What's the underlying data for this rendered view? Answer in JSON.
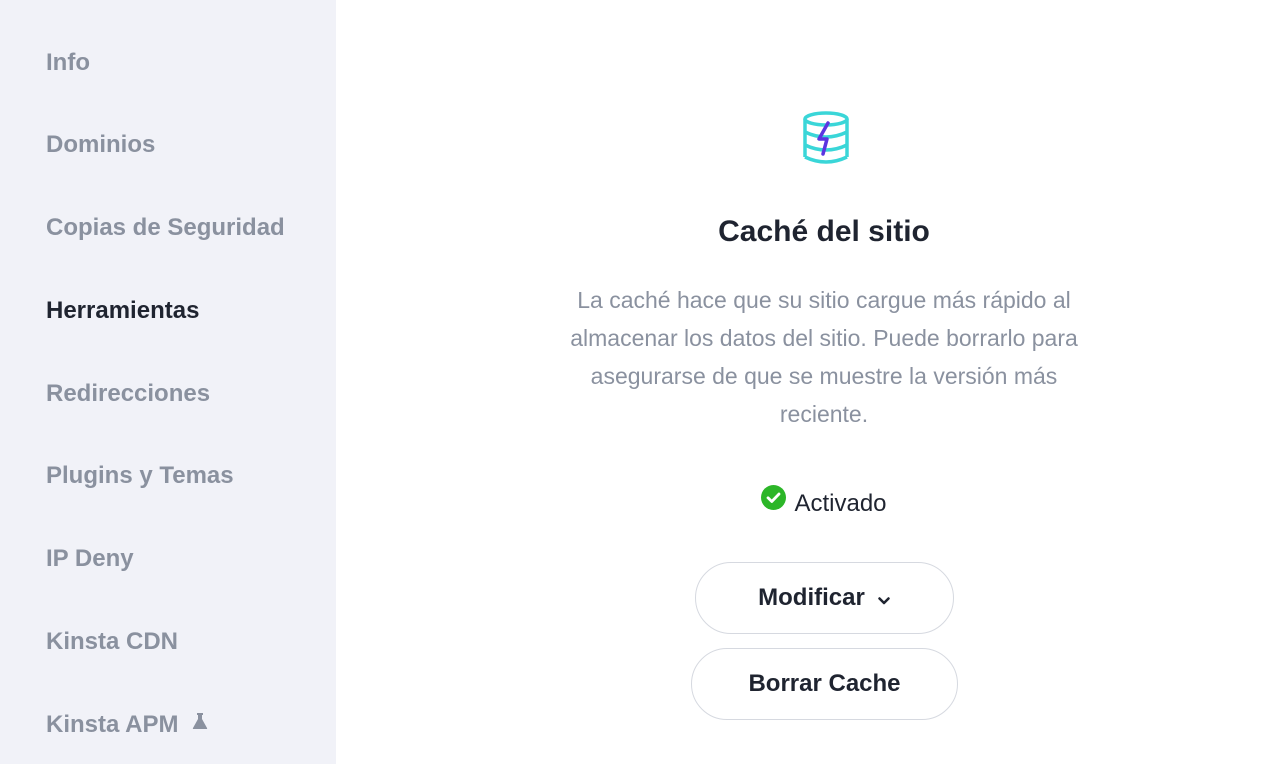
{
  "sidebar": {
    "items": [
      {
        "label": "Info",
        "active": false
      },
      {
        "label": "Dominios",
        "active": false
      },
      {
        "label": "Copias de Seguridad",
        "active": false
      },
      {
        "label": "Herramientas",
        "active": true
      },
      {
        "label": "Redirecciones",
        "active": false
      },
      {
        "label": "Plugins y Temas",
        "active": false
      },
      {
        "label": "IP Deny",
        "active": false
      },
      {
        "label": "Kinsta CDN",
        "active": false
      },
      {
        "label": "Kinsta APM",
        "active": false,
        "icon": "flask-icon"
      }
    ]
  },
  "main": {
    "icon": "cache-database-bolt-icon",
    "title": "Caché del sitio",
    "description": "La caché hace que su sitio cargue más rápido al almacenar los datos del sitio. Puede borrarlo para asegurarse de que se muestre la versión más reciente.",
    "status": {
      "icon": "check-circle-icon",
      "label": "Activado",
      "color": "#2cb628"
    },
    "buttons": {
      "modify_label": "Modificar",
      "modify_icon": "chevron-down-icon",
      "clear_label": "Borrar Cache"
    }
  },
  "colors": {
    "sidebar_bg": "#f1f2f8",
    "text_dark": "#1f2430",
    "text_muted": "#8a919f",
    "icon_teal": "#3ad6d8",
    "icon_purple": "#5b35e0"
  }
}
